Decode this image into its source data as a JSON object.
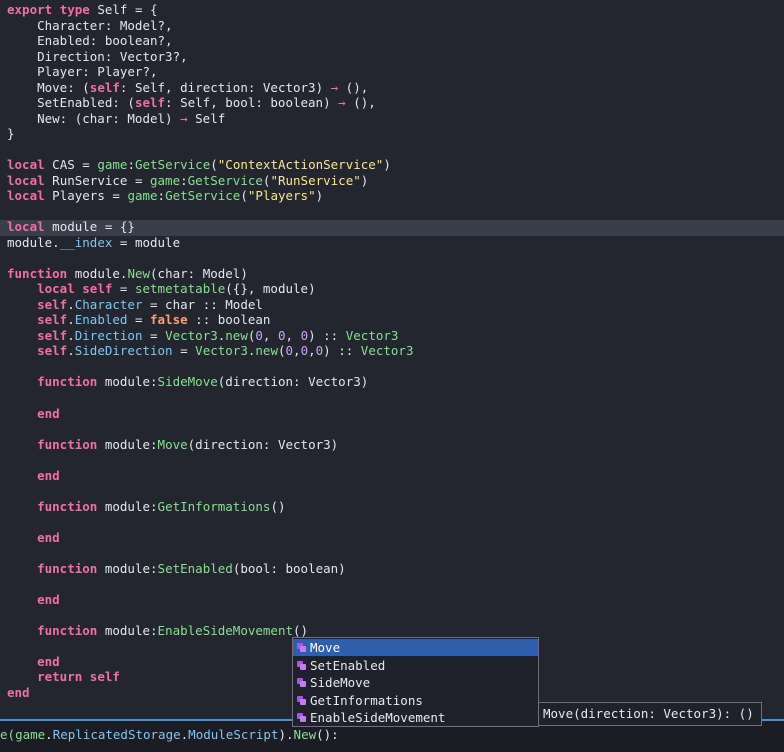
{
  "colors": {
    "background": "#23252f",
    "keyword": "#f26fa6",
    "string": "#fbe68e",
    "function": "#86e18f",
    "number": "#c9a3f6",
    "literal": "#ff9f7a",
    "property": "#7dc8f4",
    "selection": "#2d5fae",
    "bottom_bar_border": "#4a90d6"
  },
  "code_lines": [
    [
      {
        "t": "export",
        "c": "kw"
      },
      {
        "t": " "
      },
      {
        "t": "type",
        "c": "kw"
      },
      {
        "t": " Self = {"
      }
    ],
    [
      {
        "t": "    Character: Model?,"
      }
    ],
    [
      {
        "t": "    Enabled: boolean?,"
      }
    ],
    [
      {
        "t": "    Direction: Vector3?,"
      }
    ],
    [
      {
        "t": "    Player: Player?,"
      }
    ],
    [
      {
        "t": "    Move: ("
      },
      {
        "t": "self",
        "c": "kw"
      },
      {
        "t": ": Self, direction: Vector3) "
      },
      {
        "t": "→",
        "c": "op"
      },
      {
        "t": " (),"
      }
    ],
    [
      {
        "t": "    SetEnabled: ("
      },
      {
        "t": "self",
        "c": "kw"
      },
      {
        "t": ": Self, bool: boolean) "
      },
      {
        "t": "→",
        "c": "op"
      },
      {
        "t": " (),"
      }
    ],
    [
      {
        "t": "    New: (char: Model) "
      },
      {
        "t": "→",
        "c": "op"
      },
      {
        "t": " Self"
      }
    ],
    [
      {
        "t": "}"
      }
    ],
    [],
    [
      {
        "t": "local",
        "c": "kw"
      },
      {
        "t": " CAS = "
      },
      {
        "t": "game",
        "c": "fn"
      },
      {
        "t": ":"
      },
      {
        "t": "GetService",
        "c": "fn"
      },
      {
        "t": "("
      },
      {
        "t": "\"ContextActionService\"",
        "c": "str"
      },
      {
        "t": ")"
      }
    ],
    [
      {
        "t": "local",
        "c": "kw"
      },
      {
        "t": " RunService = "
      },
      {
        "t": "game",
        "c": "fn"
      },
      {
        "t": ":"
      },
      {
        "t": "GetService",
        "c": "fn"
      },
      {
        "t": "("
      },
      {
        "t": "\"RunService\"",
        "c": "str"
      },
      {
        "t": ")"
      }
    ],
    [
      {
        "t": "local",
        "c": "kw"
      },
      {
        "t": " Players = "
      },
      {
        "t": "game",
        "c": "fn"
      },
      {
        "t": ":"
      },
      {
        "t": "GetService",
        "c": "fn"
      },
      {
        "t": "("
      },
      {
        "t": "\"Players\"",
        "c": "str"
      },
      {
        "t": ")"
      }
    ],
    [],
    [
      {
        "t": "local",
        "c": "kw"
      },
      {
        "t": " module = {}"
      }
    ],
    [
      {
        "t": "module."
      },
      {
        "t": "__index",
        "c": "prop"
      },
      {
        "t": " = module"
      }
    ],
    [],
    [
      {
        "t": "function",
        "c": "kw"
      },
      {
        "t": " module."
      },
      {
        "t": "New",
        "c": "fn"
      },
      {
        "t": "(char: Model)"
      }
    ],
    [
      {
        "t": "    "
      },
      {
        "t": "local",
        "c": "kw"
      },
      {
        "t": " "
      },
      {
        "t": "self",
        "c": "kw"
      },
      {
        "t": " = "
      },
      {
        "t": "setmetatable",
        "c": "fn"
      },
      {
        "t": "({}, module)"
      }
    ],
    [
      {
        "t": "    "
      },
      {
        "t": "self",
        "c": "kw"
      },
      {
        "t": "."
      },
      {
        "t": "Character",
        "c": "prop"
      },
      {
        "t": " = char :: Model"
      }
    ],
    [
      {
        "t": "    "
      },
      {
        "t": "self",
        "c": "kw"
      },
      {
        "t": "."
      },
      {
        "t": "Enabled",
        "c": "prop"
      },
      {
        "t": " = "
      },
      {
        "t": "false",
        "c": "lit"
      },
      {
        "t": " :: boolean"
      }
    ],
    [
      {
        "t": "    "
      },
      {
        "t": "self",
        "c": "kw"
      },
      {
        "t": "."
      },
      {
        "t": "Direction",
        "c": "prop"
      },
      {
        "t": " = "
      },
      {
        "t": "Vector3",
        "c": "fn"
      },
      {
        "t": "."
      },
      {
        "t": "new",
        "c": "fn"
      },
      {
        "t": "("
      },
      {
        "t": "0",
        "c": "num"
      },
      {
        "t": ", "
      },
      {
        "t": "0",
        "c": "num"
      },
      {
        "t": ", "
      },
      {
        "t": "0",
        "c": "num"
      },
      {
        "t": ") :: "
      },
      {
        "t": "Vector3",
        "c": "fn"
      }
    ],
    [
      {
        "t": "    "
      },
      {
        "t": "self",
        "c": "kw"
      },
      {
        "t": "."
      },
      {
        "t": "SideDirection",
        "c": "prop"
      },
      {
        "t": " = "
      },
      {
        "t": "Vector3",
        "c": "fn"
      },
      {
        "t": "."
      },
      {
        "t": "new",
        "c": "fn"
      },
      {
        "t": "("
      },
      {
        "t": "0",
        "c": "num"
      },
      {
        "t": ","
      },
      {
        "t": "0",
        "c": "num"
      },
      {
        "t": ","
      },
      {
        "t": "0",
        "c": "num"
      },
      {
        "t": ") :: "
      },
      {
        "t": "Vector3",
        "c": "fn"
      }
    ],
    [],
    [
      {
        "t": "    "
      },
      {
        "t": "function",
        "c": "kw"
      },
      {
        "t": " module:"
      },
      {
        "t": "SideMove",
        "c": "fn"
      },
      {
        "t": "(direction: Vector3)"
      }
    ],
    [],
    [
      {
        "t": "    "
      },
      {
        "t": "end",
        "c": "kw"
      }
    ],
    [],
    [
      {
        "t": "    "
      },
      {
        "t": "function",
        "c": "kw"
      },
      {
        "t": " module:"
      },
      {
        "t": "Move",
        "c": "fn"
      },
      {
        "t": "(direction: Vector3)"
      }
    ],
    [],
    [
      {
        "t": "    "
      },
      {
        "t": "end",
        "c": "kw"
      }
    ],
    [],
    [
      {
        "t": "    "
      },
      {
        "t": "function",
        "c": "kw"
      },
      {
        "t": " module:"
      },
      {
        "t": "GetInformations",
        "c": "fn"
      },
      {
        "t": "()"
      }
    ],
    [],
    [
      {
        "t": "    "
      },
      {
        "t": "end",
        "c": "kw"
      }
    ],
    [],
    [
      {
        "t": "    "
      },
      {
        "t": "function",
        "c": "kw"
      },
      {
        "t": " module:"
      },
      {
        "t": "SetEnabled",
        "c": "fn"
      },
      {
        "t": "(bool: boolean)"
      }
    ],
    [],
    [
      {
        "t": "    "
      },
      {
        "t": "end",
        "c": "kw"
      }
    ],
    [],
    [
      {
        "t": "    "
      },
      {
        "t": "function",
        "c": "kw"
      },
      {
        "t": " module:"
      },
      {
        "t": "EnableSideMovement",
        "c": "fn"
      },
      {
        "t": "()"
      }
    ],
    [],
    [
      {
        "t": "    "
      },
      {
        "t": "end",
        "c": "kw"
      }
    ],
    [
      {
        "t": "    "
      },
      {
        "t": "return",
        "c": "kw"
      },
      {
        "t": " "
      },
      {
        "t": "self",
        "c": "kw"
      }
    ],
    [
      {
        "t": "end",
        "c": "kw"
      }
    ]
  ],
  "bottom_command": [
    {
      "t": "e(",
      "c": "fn"
    },
    {
      "t": "game",
      "c": "fn"
    },
    {
      "t": "."
    },
    {
      "t": "ReplicatedStorage",
      "c": "prop"
    },
    {
      "t": "."
    },
    {
      "t": "ModuleScript",
      "c": "prop"
    },
    {
      "t": ")."
    },
    {
      "t": "New",
      "c": "fn"
    },
    {
      "t": "():"
    }
  ],
  "autocomplete": {
    "items": [
      {
        "label": "Move",
        "icon": "method-icon",
        "selected": true
      },
      {
        "label": "SetEnabled",
        "icon": "method-icon",
        "selected": false
      },
      {
        "label": "SideMove",
        "icon": "method-icon",
        "selected": false
      },
      {
        "label": "GetInformations",
        "icon": "method-icon",
        "selected": false
      },
      {
        "label": "EnableSideMovement",
        "icon": "method-icon",
        "selected": false
      }
    ]
  },
  "signature_tooltip": "Move(direction: Vector3): ()"
}
